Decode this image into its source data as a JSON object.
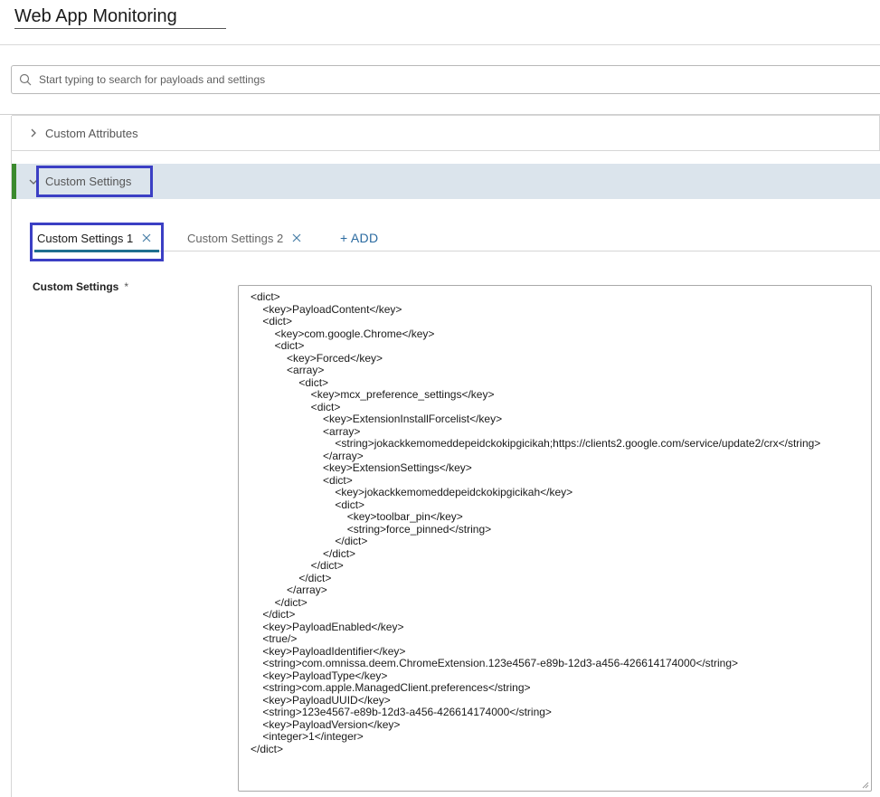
{
  "page": {
    "title": "Web App Monitoring"
  },
  "search": {
    "placeholder": "Start typing to search for payloads and settings"
  },
  "accordions": {
    "custom_attributes": {
      "label": "Custom Attributes"
    },
    "custom_settings": {
      "label": "Custom Settings"
    }
  },
  "tabs": [
    {
      "label": "Custom Settings 1"
    },
    {
      "label": "Custom Settings 2"
    }
  ],
  "add_label": "+ ADD",
  "field": {
    "label": "Custom Settings",
    "required_marker": "*",
    "lines": [
      "<dict>",
      "    <key>PayloadContent</key>",
      "    <dict>",
      "        <key>com.google.Chrome</key>",
      "        <dict>",
      "            <key>Forced</key>",
      "            <array>",
      "                <dict>",
      "                    <key>mcx_preference_settings</key>",
      "                    <dict>",
      "                        <key>ExtensionInstallForcelist</key>",
      "                        <array>",
      "                            <string>jokackkemomeddepeidckokipgicikah;https://clients2.google.com/service/update2/crx</string>",
      "                        </array>",
      "                        <key>ExtensionSettings</key>",
      "                        <dict>",
      "                            <key>jokackkemomeddepeidckokipgicikah</key>",
      "                            <dict>",
      "                                <key>toolbar_pin</key>",
      "                                <string>force_pinned</string>",
      "                            </dict>",
      "                        </dict>",
      "                    </dict>",
      "                </dict>",
      "            </array>",
      "        </dict>",
      "    </dict>",
      "    <key>PayloadEnabled</key>",
      "    <true/>",
      "    <key>PayloadIdentifier</key>",
      "    <string>com.omnissa.deem.ChromeExtension.123e4567-e89b-12d3-a456-426614174000</string>",
      "    <key>PayloadType</key>",
      "    <string>com.apple.ManagedClient.preferences</string>",
      "    <key>PayloadUUID</key>",
      "    <string>123e4567-e89b-12d3-a456-426614174000</string>",
      "    <key>PayloadVersion</key>",
      "    <integer>1</integer>",
      "</dict>"
    ]
  },
  "icons": {
    "search": "search-icon",
    "collapsed": "chevron-right-icon",
    "expanded": "chevron-down-icon",
    "close": "close-icon"
  },
  "colors": {
    "accent_green": "#3b8a2e",
    "highlight_outline": "#3b3fc4",
    "tab_underline": "#1f6f8f",
    "expanded_bg": "#dbe4ec",
    "link_blue": "#2a6aa0"
  }
}
